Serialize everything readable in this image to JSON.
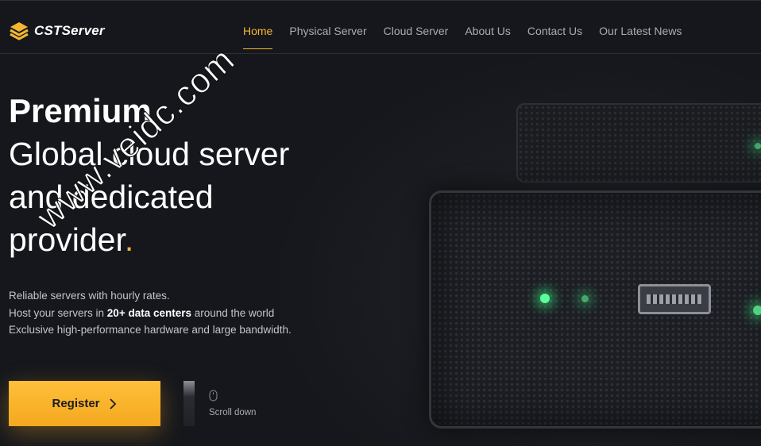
{
  "brand": {
    "name": "CSTServer",
    "accent": "#f5b731"
  },
  "nav": {
    "items": [
      {
        "label": "Home",
        "active": true
      },
      {
        "label": "Physical Server",
        "active": false
      },
      {
        "label": "Cloud Server",
        "active": false
      },
      {
        "label": "About Us",
        "active": false
      },
      {
        "label": "Contact Us",
        "active": false
      },
      {
        "label": "Our Latest News",
        "active": false
      }
    ]
  },
  "hero": {
    "title_bold": "Premium",
    "title_line1": "Global cloud server",
    "title_line2": "and dedicated",
    "title_line3": "provider",
    "title_dot": ".",
    "desc_line1": "Reliable servers with hourly rates.",
    "desc_line2_pre": "Host your servers in ",
    "desc_line2_bold": "20+ data centers",
    "desc_line2_post": " around the world",
    "desc_line3": "Exclusive high-performance hardware and large bandwidth."
  },
  "cta": {
    "register_label": "Register"
  },
  "scroll": {
    "label": "Scroll down",
    "icon": "mouse-icon"
  },
  "watermark": {
    "text": "www.veidc.com"
  }
}
